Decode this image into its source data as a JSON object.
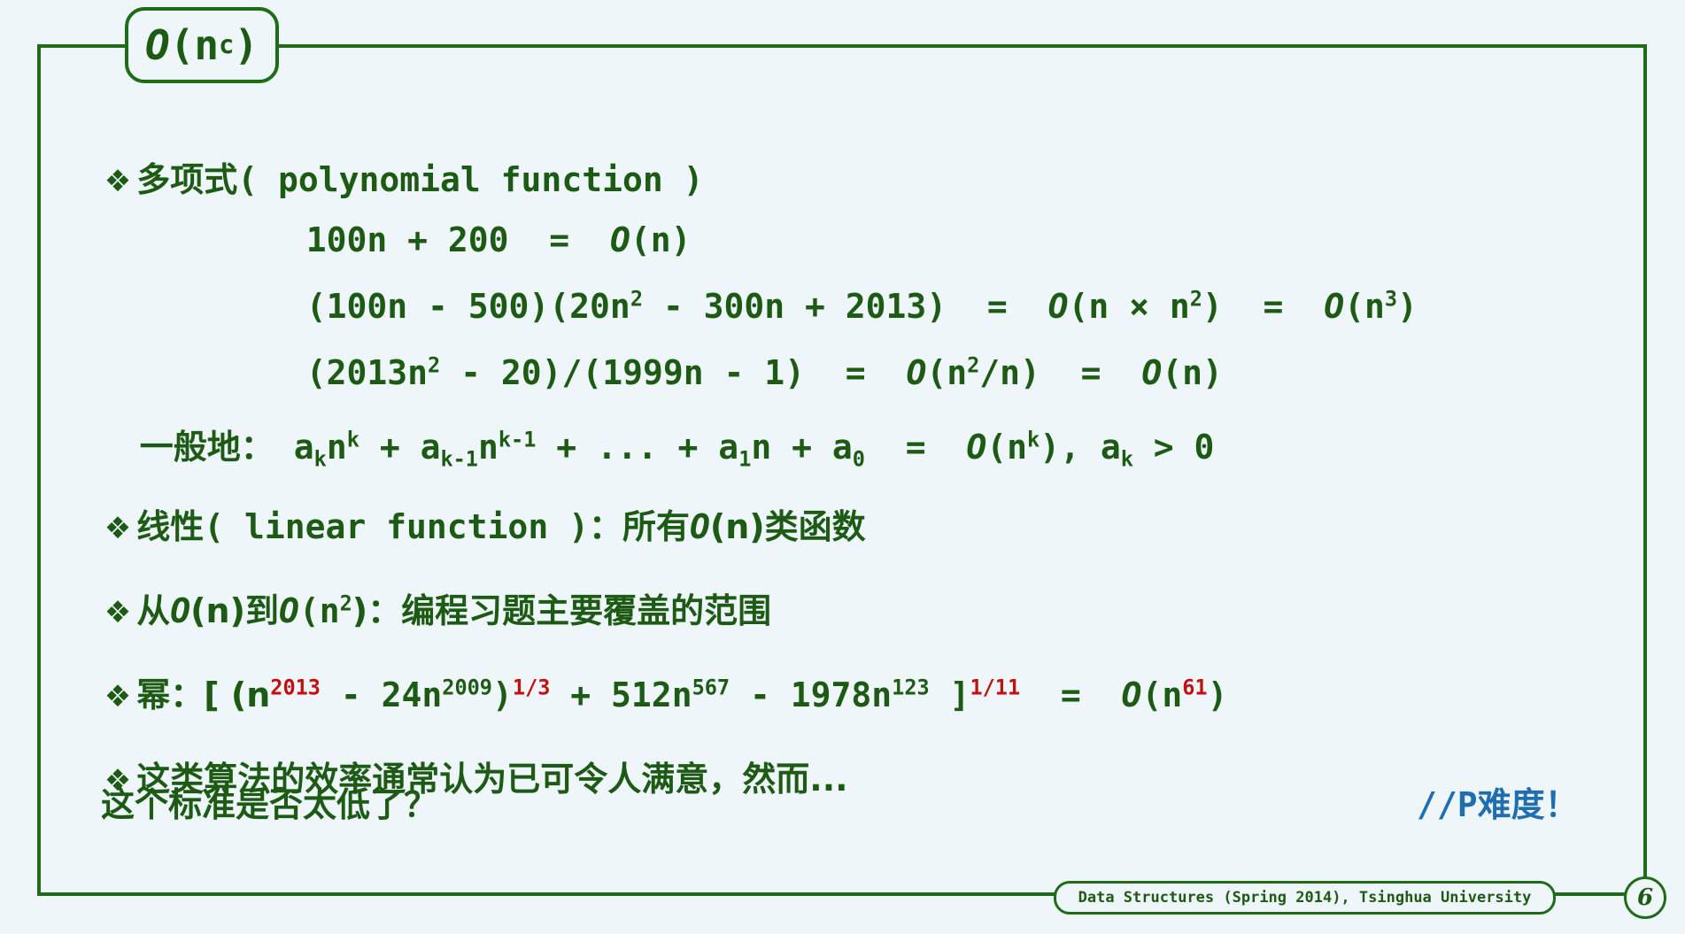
{
  "title": {
    "o": "O",
    "rest": "(n",
    "sup": "c",
    "close": ")"
  },
  "bullets": {
    "b1_label": "多项式",
    "b1_paren": "( polynomial function )",
    "b2_label": "线性",
    "b2_paren": "( linear function )",
    "b2_tail1": "：所有",
    "b2_tail2": "(n)类函数",
    "b3_a": "从",
    "b3_b": "(n)到",
    "b3_c": "(n",
    "b3_d": ")：编程习题主要覆盖的范围",
    "b4_a": "幂：[ (n",
    "b4_sup1": "2013",
    "b4_b": " - 24n",
    "b4_sup2": "2009",
    "b4_c": ")",
    "b4_sup3": "1/3",
    "b4_d": " + 512n",
    "b4_sup4": "567",
    "b4_e": " - 1978n",
    "b4_sup5": "123",
    "b4_f": " ]",
    "b4_sup6": "1/11",
    "b4_g": "  =  ",
    "b4_h": "(n",
    "b4_sup7": "61",
    "b4_i": ")",
    "b5_line1": "这类算法的效率通常认为已可令人满意，然而...",
    "b5_line2": "这个标准是否太低了？",
    "b5_note": "//P难度！"
  },
  "eq1": {
    "lhs": "100n + 200  =  ",
    "rhs": "(n)"
  },
  "eq2": {
    "a": "(100n - 500)(20n",
    "s1": "2",
    "b": " - 300n + 2013)  =  ",
    "c": "(n × n",
    "s2": "2",
    "d": ")  =  ",
    "e": "(n",
    "s3": "3",
    "f": ")"
  },
  "eq3": {
    "a": "(2013n",
    "s1": "2",
    "b": " - 20)/(1999n - 1)  =  ",
    "c": "(n",
    "s2": "2",
    "d": "/n)  =  ",
    "e": "(n)"
  },
  "eq4": {
    "label": "一般地：",
    "a": "a",
    "sub1": "k",
    "b": "n",
    "sup1": "k",
    "c": " + a",
    "sub2": "k-1",
    "d": "n",
    "sup2": "k-1",
    "e": " + ... + a",
    "sub3": "1",
    "f": "n + a",
    "sub4": "0",
    "g": "  =  ",
    "h": "(n",
    "sup3": "k",
    "i": "), a",
    "sub5": "k",
    "j": " > 0"
  },
  "bigO": "O",
  "footer": "Data Structures (Spring 2014), Tsinghua University",
  "page_number": "6",
  "colors": {
    "green": "#1d5a14",
    "frame": "#1e6b18",
    "red": "#c01010",
    "blue": "#1f6fb0",
    "background": "#eef6fa"
  }
}
